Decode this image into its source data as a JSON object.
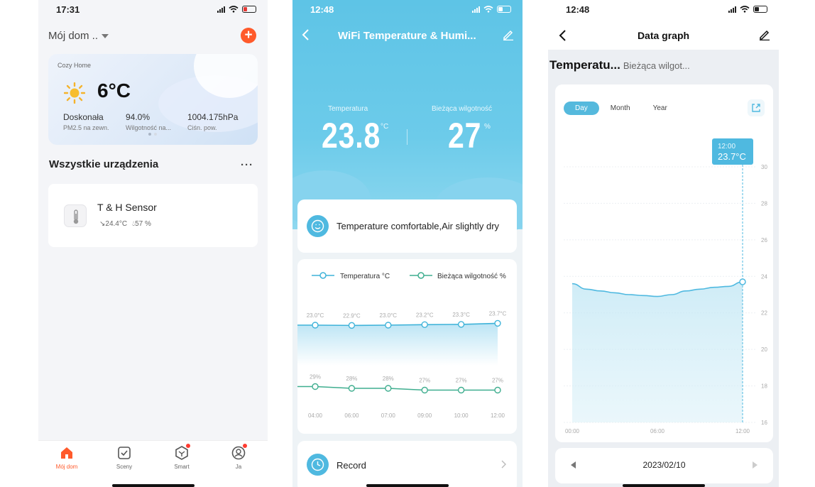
{
  "phone1": {
    "time": "17:31",
    "home_title": "Mój dom ..",
    "weather": {
      "location": "Cozy Home",
      "temp": "6°C",
      "stats": [
        {
          "value": "Doskonała",
          "label": "PM2.5 na zewn."
        },
        {
          "value": "94.0%",
          "label": "Wilgotność na..."
        },
        {
          "value": "1004.175hPa",
          "label": "Ciśn. pow."
        }
      ]
    },
    "devices_title": "Wszystkie urządzenia",
    "device": {
      "name": "T & H Sensor",
      "temp": "24.4°C",
      "humidity": "57 %"
    },
    "tabs": [
      {
        "label": "Mój dom",
        "icon": "home-icon",
        "active": true
      },
      {
        "label": "Sceny",
        "icon": "scenes-icon"
      },
      {
        "label": "Smart",
        "icon": "smart-icon"
      },
      {
        "label": "Ja",
        "icon": "profile-icon"
      }
    ]
  },
  "phone2": {
    "time": "12:48",
    "title": "WiFi Temperature & Humi...",
    "temp_label": "Temperatura",
    "temp_value": "23.8",
    "temp_unit": "°C",
    "hum_label": "Bieżąca wilgotność",
    "hum_value": "27",
    "hum_unit": "%",
    "comfort_text": "Temperature comfortable,Air slightly dry",
    "record_label": "Record"
  },
  "phone3": {
    "time": "12:48",
    "title": "Data graph",
    "tab_active": "Temperatu...",
    "tab_other": "Bieżąca wilgot...",
    "ranges": [
      "Day",
      "Month",
      "Year"
    ],
    "active_range": "Day",
    "tooltip_time": "12:00",
    "tooltip_value": "23.7°C",
    "date": "2023/02/10"
  },
  "chart_data": [
    {
      "type": "line",
      "legend": [
        "Temperatura °C",
        "Bieżąca wilgotność %"
      ],
      "x": [
        "04:00",
        "06:00",
        "07:00",
        "09:00",
        "10:00",
        "12:00"
      ],
      "series": [
        {
          "name": "Temperatura °C",
          "values": [
            23.0,
            22.9,
            23.0,
            23.2,
            23.3,
            23.7
          ],
          "labels": [
            "23.0°C",
            "22.9°C",
            "23.0°C",
            "23.2°C",
            "23.3°C",
            "23.7°C"
          ],
          "color": "#3fb3d9"
        },
        {
          "name": "Bieżąca wilgotność %",
          "values": [
            29,
            28,
            28,
            27,
            27,
            27
          ],
          "labels": [
            "29%",
            "28%",
            "28%",
            "27%",
            "27%",
            "27%"
          ],
          "color": "#3fae8f"
        }
      ]
    },
    {
      "type": "area",
      "x_ticks": [
        "00:00",
        "06:00",
        "12:00"
      ],
      "y_ticks": [
        30,
        28,
        26,
        24,
        22,
        20,
        18,
        16
      ],
      "ylim": [
        16,
        30
      ],
      "points": [
        [
          0,
          23.6
        ],
        [
          1,
          23.3
        ],
        [
          2,
          23.2
        ],
        [
          3,
          23.1
        ],
        [
          4,
          23.0
        ],
        [
          5,
          22.95
        ],
        [
          6,
          22.9
        ],
        [
          7,
          23.0
        ],
        [
          8,
          23.2
        ],
        [
          9,
          23.3
        ],
        [
          10,
          23.4
        ],
        [
          11,
          23.45
        ],
        [
          12,
          23.7
        ]
      ],
      "highlight": {
        "x": "12:00",
        "value": 23.7
      },
      "color": "#4fb9e0"
    }
  ]
}
